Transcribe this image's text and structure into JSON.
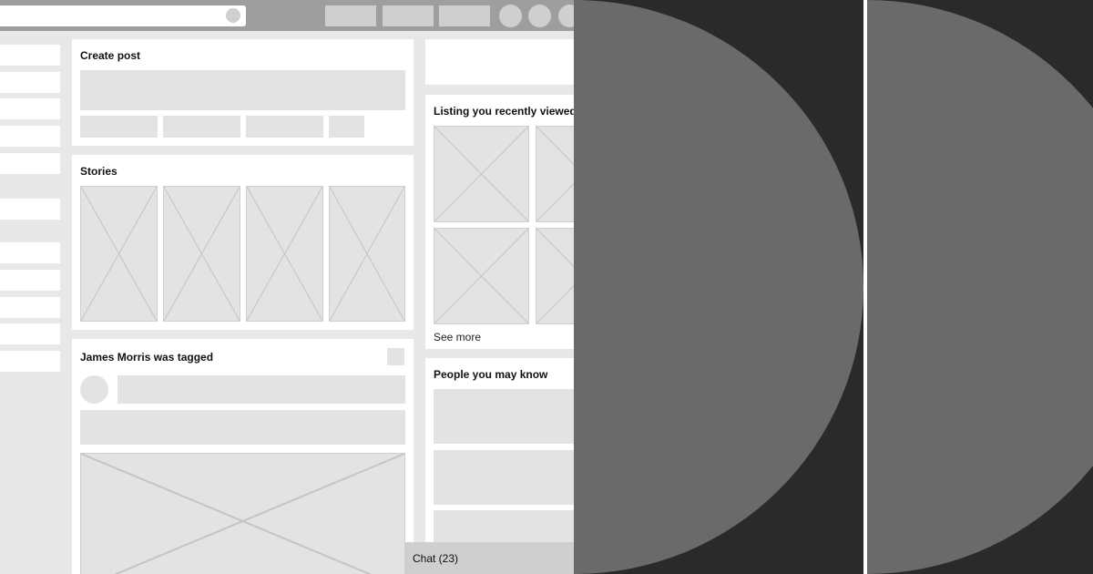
{
  "create_post": {
    "title": "Create post"
  },
  "stories": {
    "title": "Stories"
  },
  "tagged_post": {
    "title": "James Morris was tagged"
  },
  "recently_viewed": {
    "title": "Listing you recently viewed",
    "see_more": "See more"
  },
  "people": {
    "title": "People you may know"
  },
  "chat": {
    "label": "Chat (23)"
  },
  "colors": {
    "topbar": "#9e9e9e",
    "page_bg": "#e8e8e8",
    "placeholder": "#e3e3e3",
    "overlay_dark": "#2a2a2a",
    "overlay_circle": "#6a6a6a"
  }
}
